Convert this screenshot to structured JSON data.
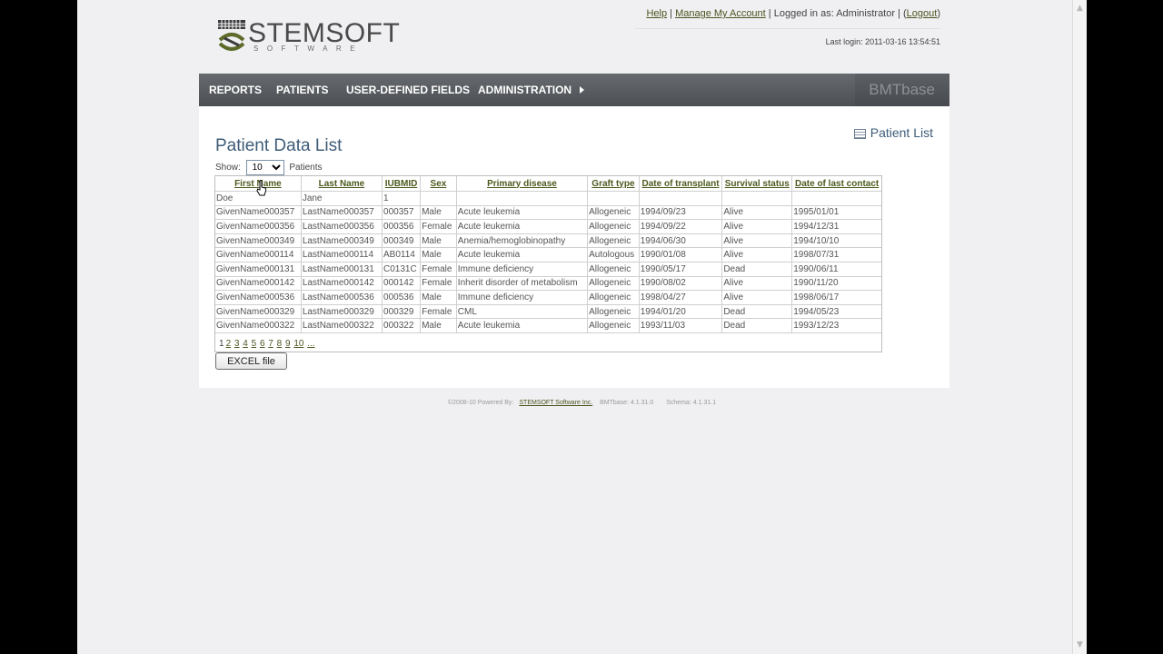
{
  "header": {
    "logo_word": "STEMSOFT",
    "logo_sub": "SOFTWARE",
    "help_link": "Help",
    "account_link": "Manage My Account",
    "logged_in_text": "Logged in as: Administrator",
    "logout_link": "Logout",
    "last_login": "Last login: 2011-03-16 13:54:51"
  },
  "nav": {
    "items": [
      "REPORTS",
      "PATIENTS",
      "USER-DEFINED FIELDS",
      "ADMINISTRATION"
    ],
    "brand": "BMTbase"
  },
  "page": {
    "title": "Patient Data List",
    "patient_list_link": "Patient List",
    "show_label": "Show:",
    "show_value": "10",
    "show_suffix": "Patients"
  },
  "table": {
    "columns": [
      "First Name",
      "Last Name",
      "IUBMID",
      "Sex",
      "Primary disease",
      "Graft type",
      "Date of transplant",
      "Survival status",
      "Date of last contact"
    ],
    "rows": [
      [
        "Doe",
        "Jane",
        "1",
        "",
        "",
        "",
        "",
        "",
        ""
      ],
      [
        "GivenName000357",
        "LastName000357",
        "000357",
        "Male",
        "Acute leukemia",
        "Allogeneic",
        "1994/09/23",
        "Alive",
        "1995/01/01"
      ],
      [
        "GivenName000356",
        "LastName000356",
        "000356",
        "Female",
        "Acute leukemia",
        "Allogeneic",
        "1994/09/22",
        "Alive",
        "1994/12/31"
      ],
      [
        "GivenName000349",
        "LastName000349",
        "000349",
        "Male",
        "Anemia/hemoglobinopathy",
        "Allogeneic",
        "1994/06/30",
        "Alive",
        "1994/10/10"
      ],
      [
        "GivenName000114",
        "LastName000114",
        "AB0114",
        "Male",
        "Acute leukemia",
        "Autologous",
        "1990/01/08",
        "Alive",
        "1998/07/31"
      ],
      [
        "GivenName000131",
        "LastName000131",
        "C0131C",
        "Female",
        "Immune deficiency",
        "Allogeneic",
        "1990/05/17",
        "Dead",
        "1990/06/11"
      ],
      [
        "GivenName000142",
        "LastName000142",
        "000142",
        "Female",
        "Inherit disorder of metabolism",
        "Allogeneic",
        "1990/08/02",
        "Alive",
        "1990/11/20"
      ],
      [
        "GivenName000536",
        "LastName000536",
        "000536",
        "Male",
        "Immune deficiency",
        "Allogeneic",
        "1998/04/27",
        "Alive",
        "1998/06/17"
      ],
      [
        "GivenName000329",
        "LastName000329",
        "000329",
        "Female",
        "CML",
        "Allogeneic",
        "1994/01/20",
        "Dead",
        "1994/05/23"
      ],
      [
        "GivenName000322",
        "LastName000322",
        "000322",
        "Male",
        "Acute leukemia",
        "Allogeneic",
        "1993/11/03",
        "Dead",
        "1993/12/23"
      ]
    ]
  },
  "pager": {
    "current": "1",
    "pages": [
      "2",
      "3",
      "4",
      "5",
      "6",
      "7",
      "8",
      "9",
      "10",
      "..."
    ]
  },
  "excel_button": "EXCEL file",
  "footer": {
    "powered": "©2008-10 Powered By:",
    "company": "STEMSOFT Software Inc.",
    "version": "BMTbase: 4.1.31.0",
    "schema": "Schema: 4.1.31.1"
  }
}
